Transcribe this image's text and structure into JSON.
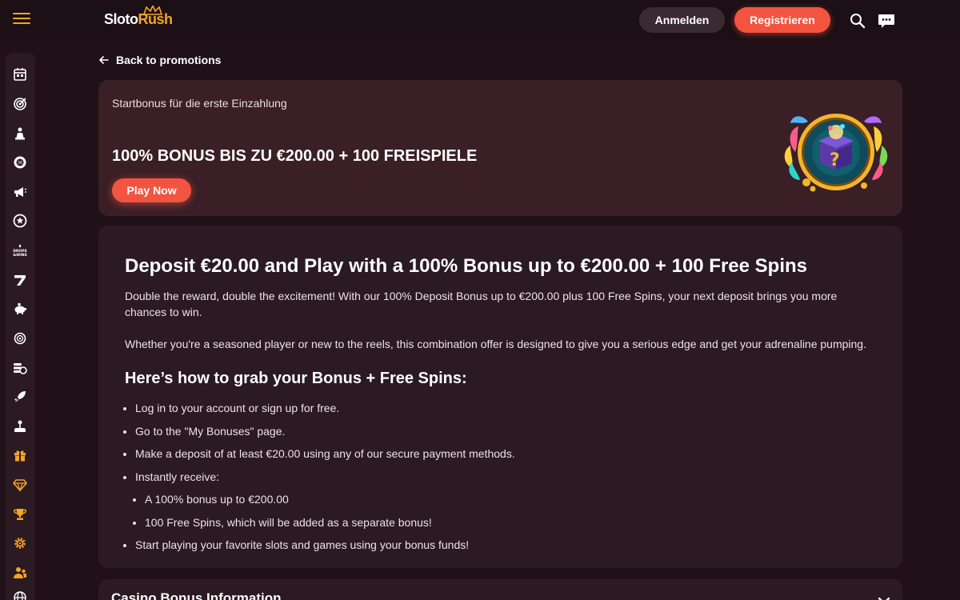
{
  "header": {
    "logo_part1": "Sloto",
    "logo_part2": "Rush",
    "login_label": "Anmelden",
    "register_label": "Registrieren",
    "accent_color": "#f2543f",
    "brand_color": "#f5a524"
  },
  "sidebar": {
    "items": [
      {
        "icon": "calendar-icon"
      },
      {
        "icon": "target-icon"
      },
      {
        "icon": "chess-piece-icon"
      },
      {
        "icon": "bingo-ball-icon"
      },
      {
        "icon": "megaphone-icon"
      },
      {
        "icon": "star-badge-icon"
      },
      {
        "icon": "drops-wins-icon"
      },
      {
        "icon": "seven-icon"
      },
      {
        "icon": "piggy-bank-icon"
      },
      {
        "icon": "roulette-icon"
      },
      {
        "icon": "coins-icon"
      },
      {
        "icon": "rocket-icon"
      },
      {
        "icon": "joystick-icon"
      },
      {
        "icon": "gift-icon"
      },
      {
        "icon": "diamond-icon"
      },
      {
        "icon": "trophy-icon"
      },
      {
        "icon": "gear-icon"
      },
      {
        "icon": "users-icon"
      },
      {
        "icon": "globe-icon"
      }
    ]
  },
  "back_label": "Back to promotions",
  "hero": {
    "subtitle": "Startbonus für die erste Einzahlung",
    "title": "100% BONUS BIS ZU €200.00 + 100 FREISPIELE",
    "cta_label": "Play Now"
  },
  "content": {
    "heading": "Deposit €20.00 and Play with a 100% Bonus up to €200.00 + 100 Free Spins",
    "para1": "Double the reward, double the excitement! With our 100% Deposit Bonus up to €200.00 plus 100 Free Spins, your next deposit brings you more chances to win.",
    "para2": "Whether you're a seasoned player or new to the reels, this combination offer is designed to give you a serious edge and get your adrenaline pumping.",
    "subheading": "Here’s how to grab your Bonus + Free Spins:",
    "steps": [
      "Log in to your account or sign up for free.",
      "Go to the \"My Bonuses\" page.",
      "Make a deposit of at least €20.00 using any of our secure payment methods.",
      "Instantly receive:"
    ],
    "sub_steps": [
      "A 100% bonus up to €200.00",
      "100 Free Spins, which will be added as a separate bonus!"
    ],
    "final_step": "Start playing your favorite slots and games using your bonus funds!"
  },
  "accordion": {
    "title": "Casino Bonus Information"
  }
}
